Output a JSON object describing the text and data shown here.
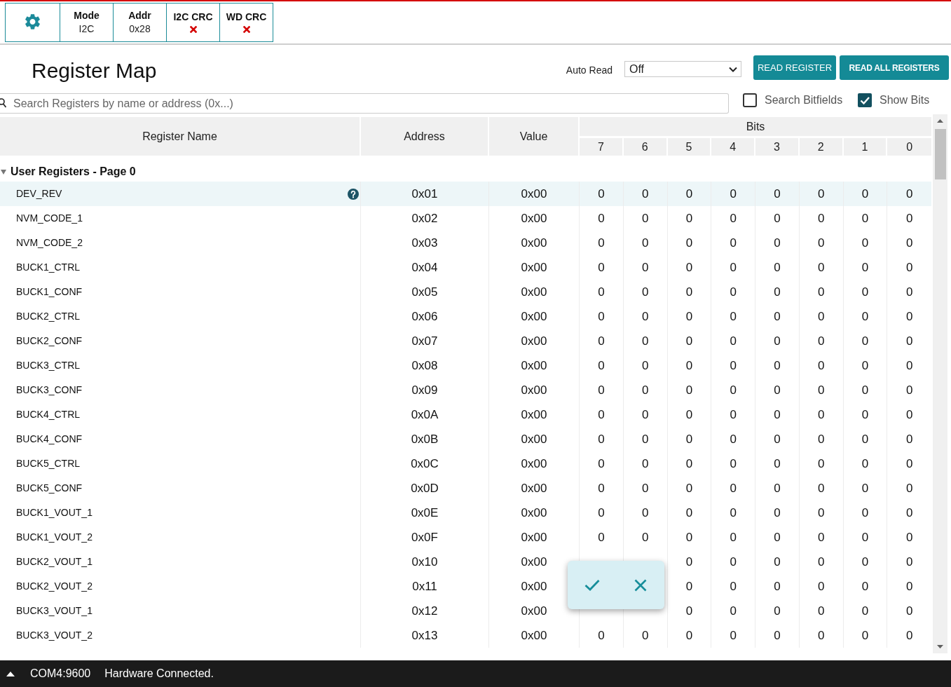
{
  "toolbar": [
    {
      "kind": "settings"
    },
    {
      "kind": "field",
      "label": "Mode",
      "value": "I2C"
    },
    {
      "kind": "field",
      "label": "Addr",
      "value": "0x28"
    },
    {
      "kind": "status",
      "label": "I2C CRC",
      "ok": false
    },
    {
      "kind": "status",
      "label": "WD CRC",
      "ok": false
    }
  ],
  "header": {
    "title": "Register Map",
    "auto_read": {
      "label": "Auto Read",
      "value": "Off"
    },
    "buttons": [
      {
        "label": "READ REGISTER",
        "bold": false
      },
      {
        "label": "READ ALL REGISTERS",
        "bold": true
      }
    ]
  },
  "search": {
    "placeholder": "Search Registers by name or address (0x...)",
    "options": [
      {
        "label": "Search Bitfields",
        "checked": false
      },
      {
        "label": "Show Bits",
        "checked": true
      }
    ]
  },
  "table": {
    "columns": [
      "Register Name",
      "Address",
      "Value"
    ],
    "bits_label": "Bits",
    "bit_columns": [
      "7",
      "6",
      "5",
      "4",
      "3",
      "2",
      "1",
      "0"
    ],
    "groups": [
      {
        "label": "User Registers - Page 0",
        "expanded": true,
        "rows": [
          {
            "name": "DEV_REV",
            "address": "0x01",
            "value": "0x00",
            "selected": true,
            "bits": [
              "0",
              "0",
              "0",
              "0",
              "0",
              "0",
              "0",
              "0"
            ]
          },
          {
            "name": "NVM_CODE_1",
            "address": "0x02",
            "value": "0x00",
            "selected": false,
            "bits": [
              "0",
              "0",
              "0",
              "0",
              "0",
              "0",
              "0",
              "0"
            ]
          },
          {
            "name": "NVM_CODE_2",
            "address": "0x03",
            "value": "0x00",
            "selected": false,
            "bits": [
              "0",
              "0",
              "0",
              "0",
              "0",
              "0",
              "0",
              "0"
            ]
          },
          {
            "name": "BUCK1_CTRL",
            "address": "0x04",
            "value": "0x00",
            "selected": false,
            "bits": [
              "0",
              "0",
              "0",
              "0",
              "0",
              "0",
              "0",
              "0"
            ]
          },
          {
            "name": "BUCK1_CONF",
            "address": "0x05",
            "value": "0x00",
            "selected": false,
            "bits": [
              "0",
              "0",
              "0",
              "0",
              "0",
              "0",
              "0",
              "0"
            ]
          },
          {
            "name": "BUCK2_CTRL",
            "address": "0x06",
            "value": "0x00",
            "selected": false,
            "bits": [
              "0",
              "0",
              "0",
              "0",
              "0",
              "0",
              "0",
              "0"
            ]
          },
          {
            "name": "BUCK2_CONF",
            "address": "0x07",
            "value": "0x00",
            "selected": false,
            "bits": [
              "0",
              "0",
              "0",
              "0",
              "0",
              "0",
              "0",
              "0"
            ]
          },
          {
            "name": "BUCK3_CTRL",
            "address": "0x08",
            "value": "0x00",
            "selected": false,
            "bits": [
              "0",
              "0",
              "0",
              "0",
              "0",
              "0",
              "0",
              "0"
            ]
          },
          {
            "name": "BUCK3_CONF",
            "address": "0x09",
            "value": "0x00",
            "selected": false,
            "bits": [
              "0",
              "0",
              "0",
              "0",
              "0",
              "0",
              "0",
              "0"
            ]
          },
          {
            "name": "BUCK4_CTRL",
            "address": "0x0A",
            "value": "0x00",
            "selected": false,
            "bits": [
              "0",
              "0",
              "0",
              "0",
              "0",
              "0",
              "0",
              "0"
            ]
          },
          {
            "name": "BUCK4_CONF",
            "address": "0x0B",
            "value": "0x00",
            "selected": false,
            "bits": [
              "0",
              "0",
              "0",
              "0",
              "0",
              "0",
              "0",
              "0"
            ]
          },
          {
            "name": "BUCK5_CTRL",
            "address": "0x0C",
            "value": "0x00",
            "selected": false,
            "bits": [
              "0",
              "0",
              "0",
              "0",
              "0",
              "0",
              "0",
              "0"
            ]
          },
          {
            "name": "BUCK5_CONF",
            "address": "0x0D",
            "value": "0x00",
            "selected": false,
            "bits": [
              "0",
              "0",
              "0",
              "0",
              "0",
              "0",
              "0",
              "0"
            ]
          },
          {
            "name": "BUCK1_VOUT_1",
            "address": "0x0E",
            "value": "0x00",
            "selected": false,
            "bits": [
              "0",
              "0",
              "0",
              "0",
              "0",
              "0",
              "0",
              "0"
            ]
          },
          {
            "name": "BUCK1_VOUT_2",
            "address": "0x0F",
            "value": "0x00",
            "selected": false,
            "bits": [
              "0",
              "0",
              "0",
              "0",
              "0",
              "0",
              "0",
              "0"
            ]
          },
          {
            "name": "BUCK2_VOUT_1",
            "address": "0x10",
            "value": "0x00",
            "selected": false,
            "bits": [
              "0",
              "0",
              "0",
              "0",
              "0",
              "0"
            ]
          },
          {
            "name": "BUCK2_VOUT_2",
            "address": "0x11",
            "value": "0x00",
            "selected": false,
            "bits": [
              "0",
              "0",
              "0",
              "0",
              "0",
              "0"
            ]
          },
          {
            "name": "BUCK3_VOUT_1",
            "address": "0x12",
            "value": "0x00",
            "selected": false,
            "bits": [
              "0",
              "0",
              "0",
              "0",
              "0",
              "0"
            ]
          },
          {
            "name": "BUCK3_VOUT_2",
            "address": "0x13",
            "value": "0x00",
            "selected": false,
            "bits": [
              "0",
              "0",
              "0",
              "0",
              "0",
              "0",
              "0",
              "0"
            ]
          }
        ]
      }
    ]
  },
  "confirm_popup": {
    "open": true
  },
  "status_bar": {
    "expanded": false,
    "port": "COM4:9600",
    "message": "Hardware Connected."
  }
}
